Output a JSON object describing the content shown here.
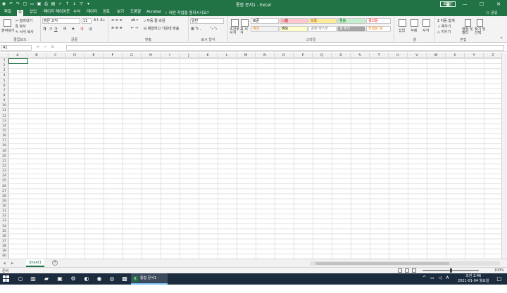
{
  "title": {
    "text": "통합 문서1  -  Excel",
    "login": "로그인"
  },
  "tabs": [
    "파일",
    "홈",
    "삽입",
    "페이지 레이아웃",
    "수식",
    "데이터",
    "검토",
    "보기",
    "도움말",
    "Acrobat"
  ],
  "active_tab": "홈",
  "tell_me": "어떤 작업을 원하시나요?",
  "share": "공유",
  "ribbon": {
    "clipboard": {
      "label": "클립보드",
      "paste": "붙여넣기",
      "cut": "잘라내기",
      "copy": "복사",
      "format_painter": "서식 복사"
    },
    "font": {
      "label": "글꼴",
      "name": "맑은 고딕",
      "size": "11"
    },
    "alignment": {
      "label": "맞춤",
      "wrap": "자동 줄 바꿈",
      "merge": "병합하고 가운데 맞춤"
    },
    "number": {
      "label": "표시 형식",
      "format": "일반"
    },
    "styles": {
      "label": "스타일",
      "cond": "조건부 서식",
      "table": "표 서식",
      "cells": [
        {
          "text": "표준",
          "bg": "#ffffff",
          "fg": "#000000"
        },
        {
          "text": "나쁨",
          "bg": "#ffc7ce",
          "fg": "#9c0006"
        },
        {
          "text": "보통",
          "bg": "#ffeb9c",
          "fg": "#9c5700"
        },
        {
          "text": "좋음",
          "bg": "#c6efce",
          "fg": "#006100"
        },
        {
          "text": "경고문",
          "bg": "#ffffff",
          "fg": "#ff0000"
        },
        {
          "text": "계산",
          "bg": "#f2f2f2",
          "fg": "#fa7d00"
        },
        {
          "text": "메모",
          "bg": "#ffffcc",
          "fg": "#000000"
        },
        {
          "text": "설명 텍스트",
          "bg": "#ffffff",
          "fg": "#7f7f7f"
        },
        {
          "text": "셀 확인",
          "bg": "#a5a5a5",
          "fg": "#ffffff"
        },
        {
          "text": "연결된 셀",
          "bg": "#ffffff",
          "fg": "#fa7d00"
        }
      ]
    },
    "cells": {
      "label": "셀",
      "insert": "삽입",
      "delete": "삭제",
      "format": "서식"
    },
    "editing": {
      "label": "편집",
      "autosum": "자동 합계",
      "fill": "채우기",
      "clear": "지우기",
      "sort": "정렬 및 필터",
      "find": "찾기 및 선택"
    }
  },
  "formula_bar": {
    "name_box": "A1",
    "fx": "fx"
  },
  "columns": [
    "A",
    "B",
    "C",
    "D",
    "E",
    "F",
    "G",
    "H",
    "I",
    "J",
    "K",
    "L",
    "M",
    "N",
    "O",
    "P",
    "Q",
    "R",
    "S",
    "T",
    "U",
    "V",
    "W",
    "X",
    "Y",
    "Z"
  ],
  "row_count": 40,
  "sheet": {
    "tab": "Sheet1",
    "add": "+"
  },
  "status": {
    "ready": "준비",
    "zoom": "100%"
  },
  "taskbar": {
    "excel": "통합 문서1 - Excel",
    "time": "오전 2:46",
    "date": "2021-01-04 월요일"
  }
}
